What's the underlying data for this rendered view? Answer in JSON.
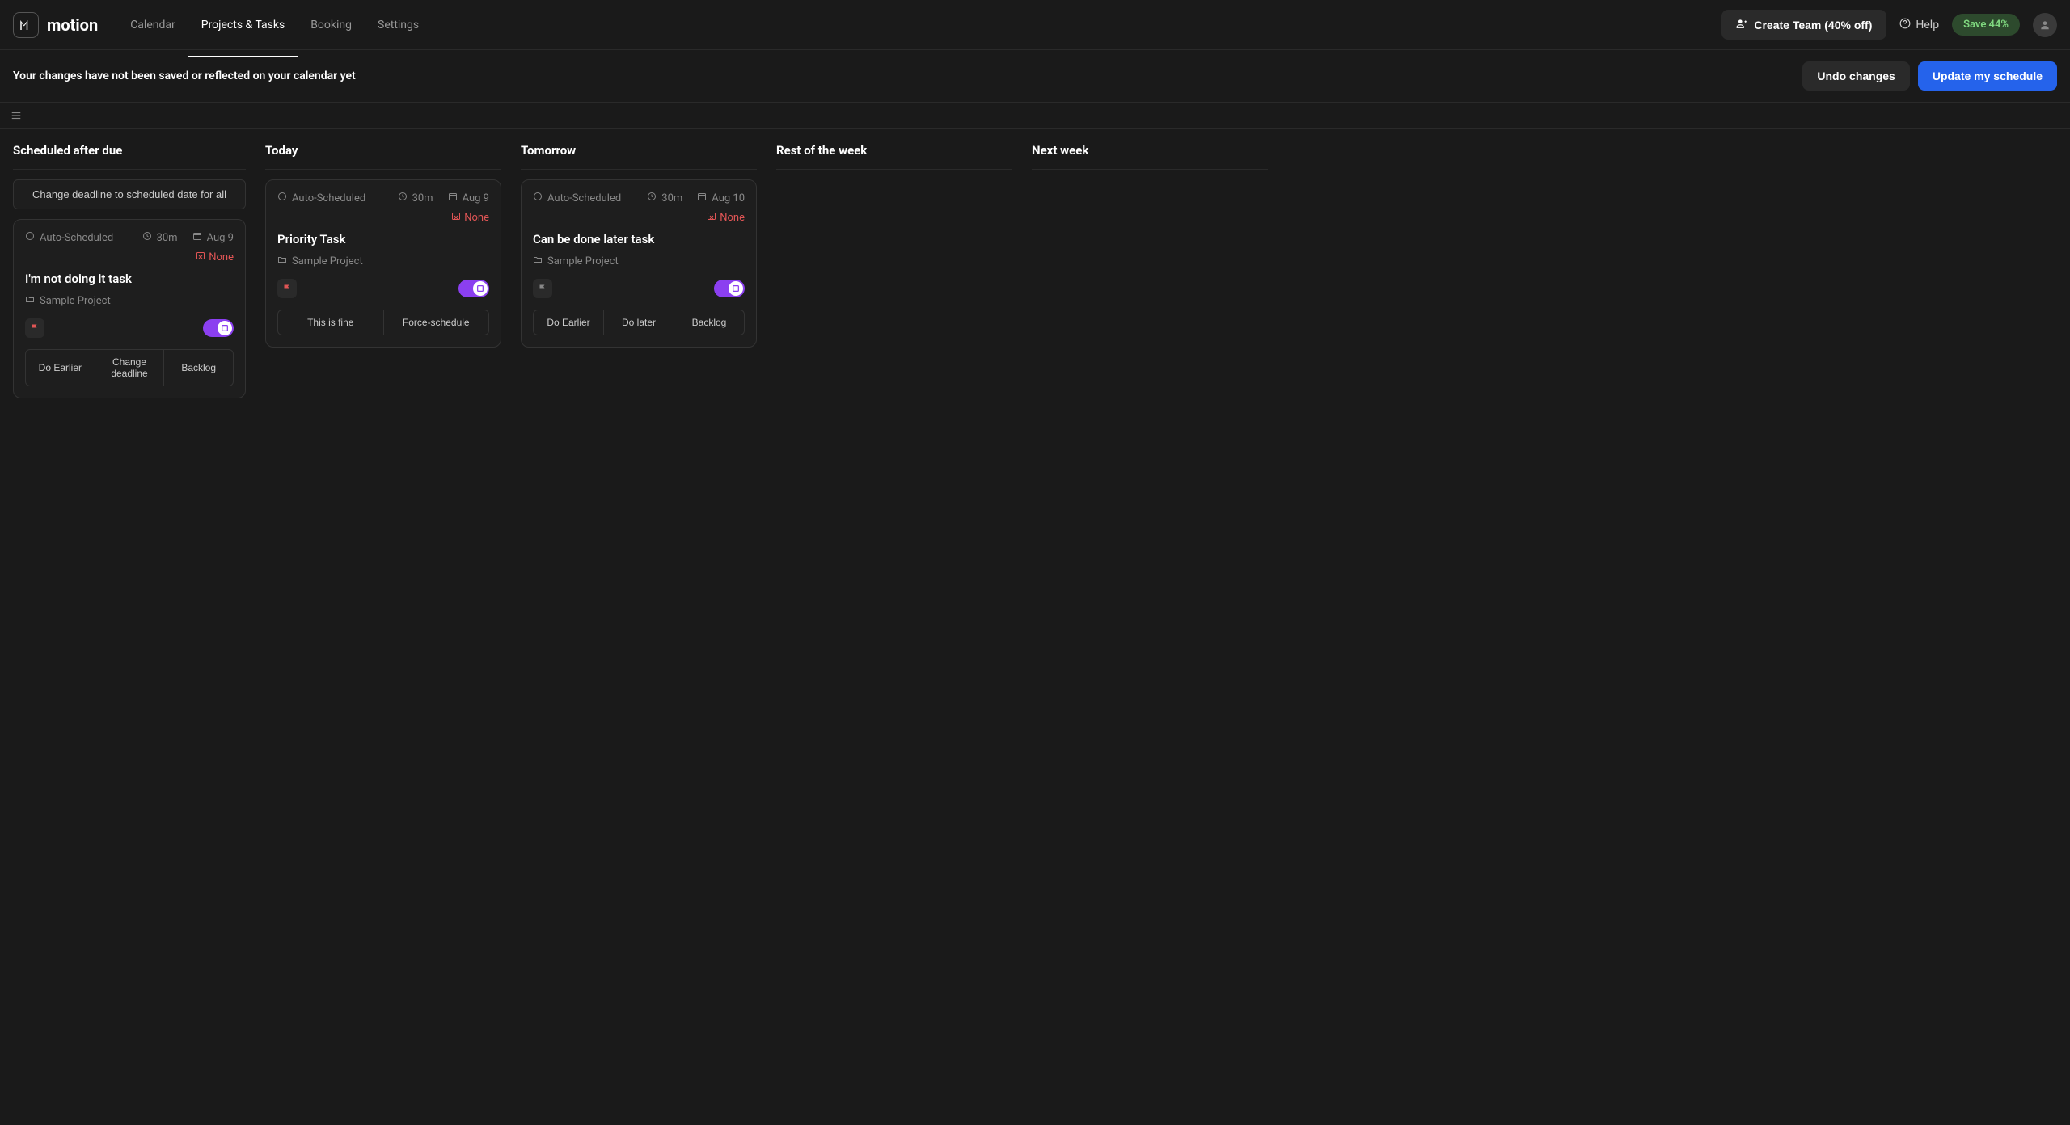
{
  "header": {
    "logo_text": "motion",
    "nav": [
      "Calendar",
      "Projects & Tasks",
      "Booking",
      "Settings"
    ],
    "active_nav_index": 1,
    "create_team_label": "Create Team (40% off)",
    "help_label": "Help",
    "save_pill": "Save 44%"
  },
  "banner": {
    "message": "Your changes have not been saved or reflected on your calendar yet",
    "undo_label": "Undo changes",
    "update_label": "Update my schedule"
  },
  "columns": [
    {
      "title": "Scheduled after due",
      "wide_action": "Change deadline to scheduled date for all",
      "tasks": [
        {
          "schedule_label": "Auto-Scheduled",
          "duration": "30m",
          "date": "Aug 9",
          "none_label": "None",
          "title": "I'm not doing it task",
          "project": "Sample Project",
          "flag": "red",
          "actions": [
            "Do Earlier",
            "Change deadline",
            "Backlog"
          ]
        }
      ]
    },
    {
      "title": "Today",
      "tasks": [
        {
          "schedule_label": "Auto-Scheduled",
          "duration": "30m",
          "date": "Aug 9",
          "none_label": "None",
          "title": "Priority Task",
          "project": "Sample Project",
          "flag": "red",
          "actions": [
            "This is fine",
            "Force-schedule"
          ]
        }
      ]
    },
    {
      "title": "Tomorrow",
      "tasks": [
        {
          "schedule_label": "Auto-Scheduled",
          "duration": "30m",
          "date": "Aug 10",
          "none_label": "None",
          "title": "Can be done later task",
          "project": "Sample Project",
          "flag": "grey",
          "actions": [
            "Do Earlier",
            "Do later",
            "Backlog"
          ]
        }
      ]
    },
    {
      "title": "Rest of the week",
      "tasks": []
    },
    {
      "title": "Next week",
      "tasks": []
    }
  ]
}
